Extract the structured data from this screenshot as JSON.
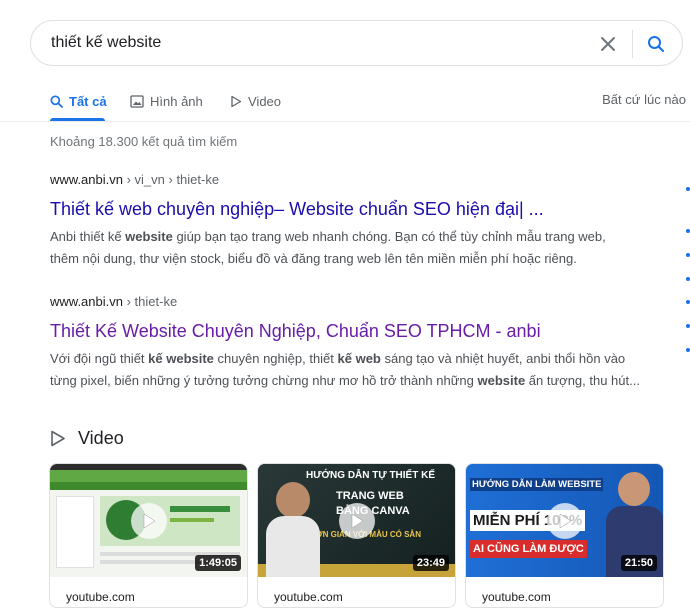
{
  "search": {
    "query": "thiết kế website"
  },
  "tabs": {
    "all": "Tất cả",
    "images": "Hình ảnh",
    "videos": "Video",
    "any_time": "Bất cứ lúc nào"
  },
  "result_stats": "Khoảng 18.300 kết quả tìm kiếm",
  "results": [
    {
      "domain": "www.anbi.vn",
      "path": " › vi_vn › thiet-ke",
      "title": "Thiết kế web chuyên nghiệp– Website chuẩn SEO hiện đại| ...",
      "snippet": {
        "a": "Anbi thiết kế ",
        "b1": "website",
        "c": " giúp bạn tạo trang web nhanh chóng. Bạn có thể tùy chỉnh mẫu trang web,",
        "line2": "thêm nội dung, thư viện stock, biểu đồ và đăng trang web lên tên miền miễn phí hoặc riêng."
      }
    },
    {
      "domain": "www.anbi.vn",
      "path": " › thiet-ke",
      "title": "Thiết Kế Website Chuyên Nghiệp, Chuẩn SEO TPHCM - anbi",
      "snippet": {
        "a": "Với đội ngũ thiết ",
        "b1": "kế website",
        "c": " chuyên nghiệp, thiết ",
        "b2": "kế web",
        "d": " sáng tạo và nhiệt huyết, anbi thổi hồn vào",
        "e": "từng pixel, biến những ý tưởng tưởng chừng như mơ hồ trở thành những ",
        "b3": "website",
        "f": " ấn tượng, thu hút..."
      }
    }
  ],
  "videos": {
    "header": "Video",
    "items": [
      {
        "duration": "1:49:05",
        "source": "youtube.com"
      },
      {
        "duration": "23:49",
        "source": "youtube.com",
        "thumb_text": [
          "HƯỚNG DẪN TỰ THIẾT KẾ",
          "TRANG WEB",
          "BẰNG CANVA",
          "ĐƠN GIẢN VỚI MẪU CÓ SẴN"
        ]
      },
      {
        "duration": "21:50",
        "source": "youtube.com",
        "thumb_text": [
          "HƯỚNG DẪN LÀM WEBSITE",
          "MIỄN PHÍ 100%",
          "AI CŨNG LÀM ĐƯỢC"
        ]
      }
    ]
  },
  "colors": {
    "link": "#1a0dab",
    "visited": "#681da8",
    "accent": "#1a73e8"
  }
}
